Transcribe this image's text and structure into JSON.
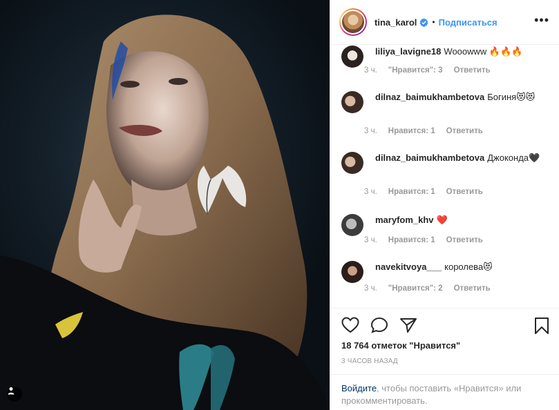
{
  "post": {
    "username": "tina_karol",
    "separator": "•",
    "follow_label": "Подписаться",
    "more_label": "•••"
  },
  "comments": [
    {
      "user": "liliya_lavigne18",
      "text": "Wooowww 🔥🔥🔥",
      "time": "3 ч.",
      "likes": "\"Нравится\": 3",
      "reply": "Ответить"
    },
    {
      "user": "dilnaz_baimukhambetova",
      "text": "Богиня😻😻",
      "time": "3 ч.",
      "likes": "Нравится: 1",
      "reply": "Ответить"
    },
    {
      "user": "dilnaz_baimukhambetova",
      "text": "Джоконда🖤",
      "time": "3 ч.",
      "likes": "Нравится: 1",
      "reply": "Ответить"
    },
    {
      "user": "maryfom_khv",
      "text": "❤️",
      "time": "3 ч.",
      "likes": "Нравится: 1",
      "reply": "Ответить"
    },
    {
      "user": "navekitvoya___",
      "text": "королева😻",
      "time": "3 ч.",
      "likes": "\"Нравится\": 2",
      "reply": "Ответить"
    }
  ],
  "footer": {
    "likes_count": "18 764 отметок \"Нравится\"",
    "time_ago": "3 часов назад",
    "login_link": "Войдите",
    "login_text": ", чтобы поставить «Нравится» или прокомментировать."
  },
  "colors": {
    "accent": "#3897f0",
    "verified": "#3897f0",
    "heart": "#ed4956"
  },
  "icons": [
    "heart-icon",
    "comment-icon",
    "share-icon",
    "bookmark-icon",
    "user-tag-icon",
    "verified-badge-icon"
  ]
}
